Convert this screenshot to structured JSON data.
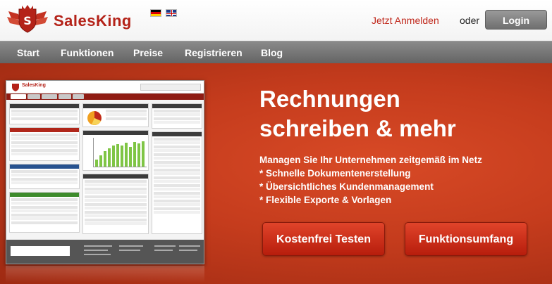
{
  "header": {
    "brand": "SalesKing",
    "languages": [
      {
        "icon": "german-flag-icon"
      },
      {
        "icon": "uk-flag-icon"
      }
    ],
    "signup_link": "Jetzt Anmelden",
    "or_text": "oder",
    "login_button": "Login"
  },
  "nav": {
    "items": [
      {
        "label": "Start"
      },
      {
        "label": "Funktionen"
      },
      {
        "label": "Preise"
      },
      {
        "label": "Registrieren"
      },
      {
        "label": "Blog"
      }
    ]
  },
  "hero": {
    "title_line1": "Rechnungen",
    "title_line2": "schreiben & mehr",
    "subtitle": "Managen Sie Ihr Unternehmen zeitgemäß im Netz",
    "features": [
      "* Schnelle Dokumentenerstellung",
      "* Übersichtliches Kundenmanagement",
      "* Flexible Exporte & Vorlagen"
    ],
    "primary_button": "Kostenfrei Testen",
    "secondary_button": "Funktionsumfang"
  },
  "preview": {
    "brand": "SalesKing"
  },
  "colors": {
    "brand_red": "#b42218",
    "hero_bg": "#c53c1d",
    "nav_bg": "#7a7a7a",
    "chart_green": "#7fc545"
  }
}
